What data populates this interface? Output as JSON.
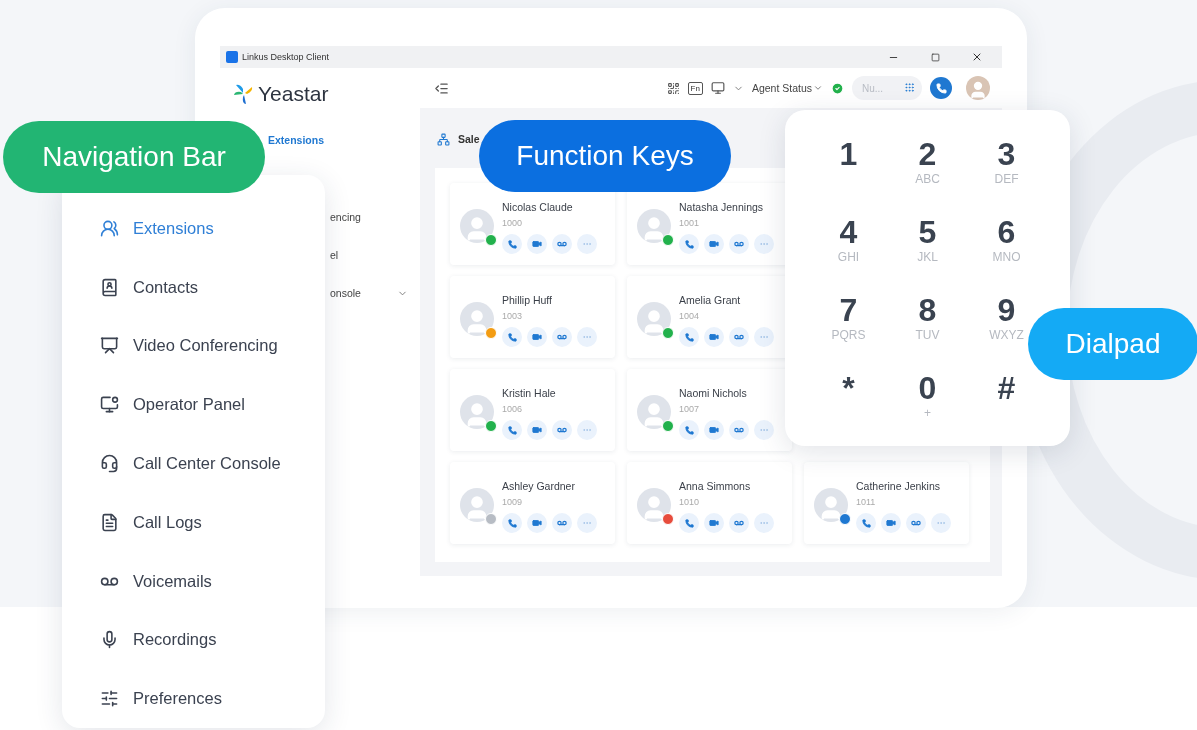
{
  "window": {
    "title": "Linkus Desktop Client"
  },
  "sidebar": {
    "logo": "Yeastar",
    "items": [
      {
        "label": "Extensions",
        "selected": true,
        "submenu": false
      },
      {
        "label": "encing",
        "selected": false,
        "submenu": false
      },
      {
        "label": "el",
        "selected": false,
        "submenu": false
      },
      {
        "label": "onsole",
        "selected": false,
        "submenu": true
      }
    ]
  },
  "toolbar": {
    "function_key": "Fn",
    "agent_status": "Agent Status",
    "search": {
      "placeholder": "Nu..."
    }
  },
  "group": {
    "title": "Sale"
  },
  "contacts": [
    {
      "name": "Nicolas Claude",
      "ext": "1000",
      "color": "#22b14c"
    },
    {
      "name": "Natasha Jennings",
      "ext": "1001",
      "color": "#22b14c"
    },
    {
      "name": "Phillip Huff",
      "ext": "1003",
      "color": "#f39c12"
    },
    {
      "name": "Amelia Grant",
      "ext": "1004",
      "color": "#22b14c"
    },
    {
      "name": "Kristin Hale",
      "ext": "1006",
      "color": "#22b14c"
    },
    {
      "name": "Naomi Nichols",
      "ext": "1007",
      "color": "#22b14c"
    },
    {
      "name": "Ashley Gardner",
      "ext": "1009",
      "color": "#b7bcc4"
    },
    {
      "name": "Anna Simmons",
      "ext": "1010",
      "color": "#e74c3c"
    },
    {
      "name": "Catherine Jenkins",
      "ext": "1011",
      "color": "#1f78d1"
    }
  ],
  "nav_panel": {
    "items": [
      {
        "label": "Extensions",
        "selected": true
      },
      {
        "label": "Contacts",
        "selected": false
      },
      {
        "label": "Video Conferencing",
        "selected": false
      },
      {
        "label": "Operator Panel",
        "selected": false
      },
      {
        "label": "Call Center Console",
        "selected": false
      },
      {
        "label": "Call Logs",
        "selected": false
      },
      {
        "label": "Voicemails",
        "selected": false
      },
      {
        "label": "Recordings",
        "selected": false
      },
      {
        "label": "Preferences",
        "selected": false
      }
    ]
  },
  "dialpad": {
    "keys": [
      {
        "digit": "1"
      },
      {
        "digit": "2",
        "letters": "ABC"
      },
      {
        "digit": "3",
        "letters": "DEF"
      },
      {
        "digit": "4",
        "letters": "GHI"
      },
      {
        "digit": "5",
        "letters": "JKL"
      },
      {
        "digit": "6",
        "letters": "MNO"
      },
      {
        "digit": "7",
        "letters": "PQRS"
      },
      {
        "digit": "8",
        "letters": "TUV"
      },
      {
        "digit": "9",
        "letters": "WXYZ"
      },
      {
        "digit": "*"
      },
      {
        "digit": "0",
        "letters": "+"
      },
      {
        "digit": "#"
      }
    ]
  },
  "callouts": [
    {
      "kind": "navigation",
      "text": "Navigation Bar"
    },
    {
      "kind": "function",
      "text": "Function Keys"
    },
    {
      "kind": "dialpad",
      "text": "Dialpad"
    }
  ]
}
